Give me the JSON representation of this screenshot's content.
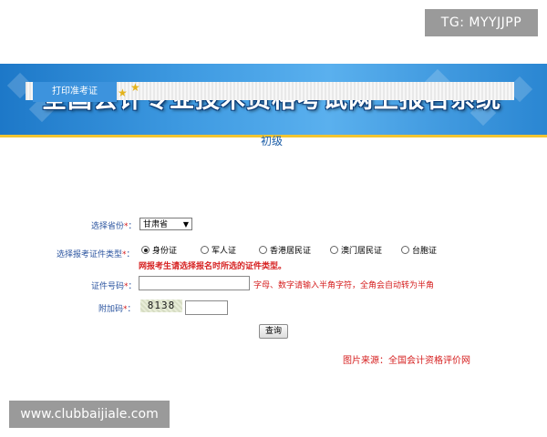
{
  "watermark_top": "TG: MYYJJPP",
  "watermark_bottom": "www.clubbaijiale.com",
  "banner": {
    "title": "全国会计专业技术资格考试网上报名系统"
  },
  "tab": {
    "label": "打印准考证"
  },
  "form": {
    "heading": "初级",
    "province": {
      "label": "选择省份",
      "value": "甘肃省"
    },
    "id_type": {
      "label": "选择报考证件类型",
      "options": [
        "身份证",
        "军人证",
        "香港居民证",
        "澳门居民证",
        "台胞证"
      ],
      "selected": "身份证",
      "warning": "网报考生请选择报名时所选的证件类型。"
    },
    "id_number": {
      "label": "证件号码",
      "value": "",
      "hint": "字母、数字请输入半角字符，全角会自动转为半角"
    },
    "captcha": {
      "label": "附加码",
      "image_text": "8138",
      "value": ""
    },
    "required_mark": "*",
    "colon": "：",
    "submit_label": "查询"
  },
  "source_note": "图片来源：全国会计资格评价网",
  "colors": {
    "banner": "#3f9be2",
    "accent_red": "#d62020",
    "label_blue": "#2c55a0"
  }
}
